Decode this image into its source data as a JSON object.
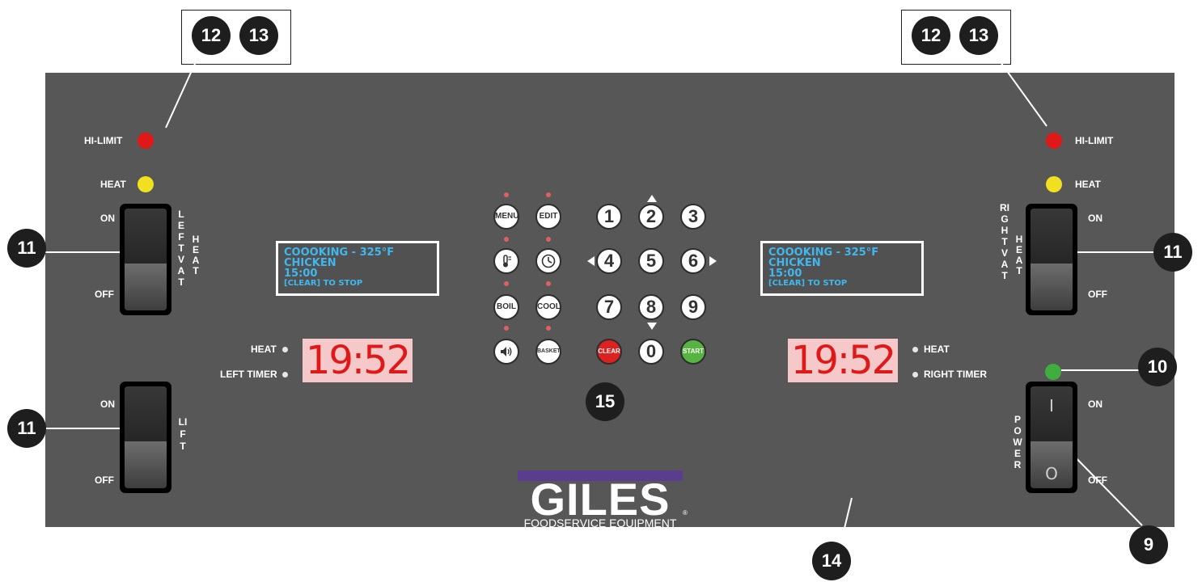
{
  "left": {
    "hi_limit_label": "HI-LIMIT",
    "heat_label": "HEAT",
    "vat_switch": {
      "on_label": "ON",
      "off_label": "OFF",
      "side_label": "LEFT VAT",
      "side_label2": "HEAT"
    },
    "lift_switch": {
      "on_label": "ON",
      "off_label": "OFF",
      "side_label": "LIFT"
    },
    "display": {
      "line1": "COOOKING - 325°F",
      "line2": "CHICKEN",
      "line3": "15:00",
      "line4": "[CLEAR] TO STOP"
    },
    "timer_heat_label": "HEAT",
    "timer_label": "LEFT TIMER",
    "timer_value": "19:52"
  },
  "right": {
    "hi_limit_label": "HI-LIMIT",
    "heat_label": "HEAT",
    "vat_switch": {
      "on_label": "ON",
      "off_label": "OFF",
      "side_label": "RIGHT VAT",
      "side_label2": "HEAT"
    },
    "power_switch": {
      "on_label": "ON",
      "off_label": "OFF",
      "side_label": "POWER",
      "on_glyph": "I",
      "off_glyph": "O"
    },
    "display": {
      "line1": "COOOKING - 325°F",
      "line2": "CHICKEN",
      "line3": "15:00",
      "line4": "[CLEAR] TO STOP"
    },
    "timer_heat_label": "HEAT",
    "timer_label": "RIGHT TIMER",
    "timer_value": "19:52"
  },
  "keypad": {
    "menu": "MENU",
    "edit": "EDIT",
    "boil": "BOIL",
    "cool": "COOL",
    "basket": "BASKET",
    "clear": "CLEAR",
    "start": "START",
    "digits": [
      "1",
      "2",
      "3",
      "4",
      "5",
      "6",
      "7",
      "8",
      "9",
      "0"
    ]
  },
  "logo": {
    "brand": "GILES",
    "subtitle": "FOODSERVICE EQUIPMENT",
    "reg": "®"
  },
  "callouts": {
    "c12_left": "12",
    "c13_left": "13",
    "c12_right": "12",
    "c13_right": "13",
    "c11_a": "11",
    "c11_b": "11",
    "c11_c": "11",
    "c10": "10",
    "c9": "9",
    "c14": "14",
    "c15": "15"
  },
  "colors": {
    "panel": "#575757",
    "hi_limit_led": "#e01818",
    "heat_led": "#f0e020",
    "power_led": "#3fae3f",
    "lcd_text": "#3fb8f0",
    "timer_bg": "#f5c9c9",
    "timer_text": "#e01818",
    "clear_key": "#dd2020",
    "start_key": "#55b540",
    "logo_stripe": "#5b3d8e"
  }
}
